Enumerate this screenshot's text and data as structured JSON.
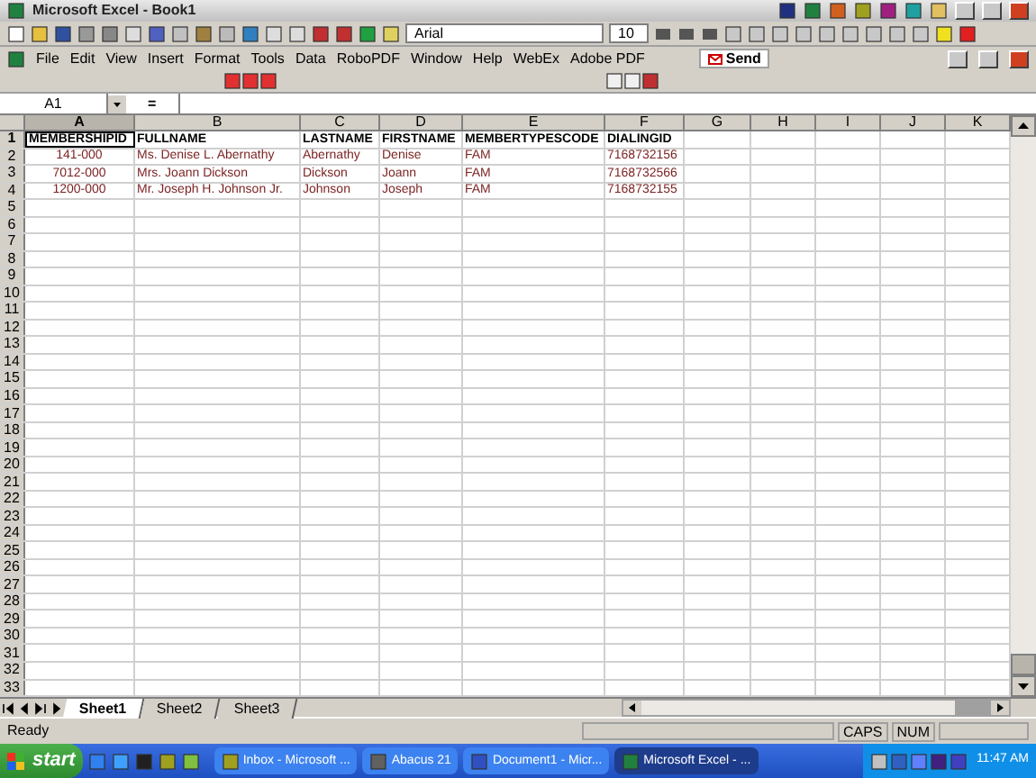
{
  "window": {
    "title": "Microsoft Excel - Book1"
  },
  "toolbar": {
    "font": "Arial",
    "size": "10"
  },
  "menu": [
    "File",
    "Edit",
    "View",
    "Insert",
    "Format",
    "Tools",
    "Data",
    "RoboPDF",
    "Window",
    "Help",
    "WebEx",
    "Adobe PDF"
  ],
  "send_button": "Send",
  "formula_bar": {
    "name_box": "A1",
    "equals": "="
  },
  "columns": [
    {
      "label": "A",
      "selected": true
    },
    {
      "label": "B",
      "selected": false
    },
    {
      "label": "C",
      "selected": false
    },
    {
      "label": "D",
      "selected": false
    },
    {
      "label": "E",
      "selected": false
    },
    {
      "label": "F",
      "selected": false
    },
    {
      "label": "G",
      "selected": false
    },
    {
      "label": "H",
      "selected": false
    },
    {
      "label": "I",
      "selected": false
    },
    {
      "label": "J",
      "selected": false
    },
    {
      "label": "K",
      "selected": false
    }
  ],
  "rows": [
    {
      "number": "1",
      "selected": true,
      "kind": "header",
      "cells": [
        "MEMBERSHIPID",
        "FULLNAME",
        "LASTNAME",
        "FIRSTNAME",
        "MEMBERTYPESCODE",
        "DIALINGID"
      ]
    },
    {
      "number": "2",
      "selected": false,
      "kind": "data",
      "cells": [
        "141-000",
        "Ms. Denise L. Abernathy",
        "Abernathy",
        "Denise",
        "FAM",
        "7168732156"
      ]
    },
    {
      "number": "3",
      "selected": false,
      "kind": "data",
      "cells": [
        "7012-000",
        "Mrs. Joann Dickson",
        "Dickson",
        "Joann",
        "FAM",
        "7168732566"
      ]
    },
    {
      "number": "4",
      "selected": false,
      "kind": "data",
      "cells": [
        "1200-000",
        "Mr. Joseph H. Johnson Jr.",
        "Johnson",
        "Joseph",
        "FAM",
        "7168732155"
      ]
    },
    {
      "number": "5",
      "selected": false,
      "kind": "empty"
    },
    {
      "number": "6",
      "selected": false,
      "kind": "empty"
    },
    {
      "number": "7",
      "selected": false,
      "kind": "empty"
    },
    {
      "number": "8",
      "selected": false,
      "kind": "empty"
    },
    {
      "number": "9",
      "selected": false,
      "kind": "empty"
    },
    {
      "number": "10",
      "selected": false,
      "kind": "empty"
    },
    {
      "number": "11",
      "selected": false,
      "kind": "empty"
    },
    {
      "number": "12",
      "selected": false,
      "kind": "empty"
    },
    {
      "number": "13",
      "selected": false,
      "kind": "empty"
    },
    {
      "number": "14",
      "selected": false,
      "kind": "empty"
    },
    {
      "number": "15",
      "selected": false,
      "kind": "empty"
    },
    {
      "number": "16",
      "selected": false,
      "kind": "empty"
    },
    {
      "number": "17",
      "selected": false,
      "kind": "empty"
    },
    {
      "number": "18",
      "selected": false,
      "kind": "empty"
    },
    {
      "number": "19",
      "selected": false,
      "kind": "empty"
    },
    {
      "number": "20",
      "selected": false,
      "kind": "empty"
    },
    {
      "number": "21",
      "selected": false,
      "kind": "empty"
    },
    {
      "number": "22",
      "selected": false,
      "kind": "empty"
    },
    {
      "number": "23",
      "selected": false,
      "kind": "empty"
    },
    {
      "number": "24",
      "selected": false,
      "kind": "empty"
    },
    {
      "number": "25",
      "selected": false,
      "kind": "empty"
    },
    {
      "number": "26",
      "selected": false,
      "kind": "empty"
    },
    {
      "number": "27",
      "selected": false,
      "kind": "empty"
    },
    {
      "number": "28",
      "selected": false,
      "kind": "empty"
    },
    {
      "number": "29",
      "selected": false,
      "kind": "empty"
    },
    {
      "number": "30",
      "selected": false,
      "kind": "empty"
    },
    {
      "number": "31",
      "selected": false,
      "kind": "empty"
    },
    {
      "number": "32",
      "selected": false,
      "kind": "empty"
    },
    {
      "number": "33",
      "selected": false,
      "kind": "empty"
    }
  ],
  "sheet_tabs": [
    {
      "label": "Sheet1",
      "selected": true
    },
    {
      "label": "Sheet2",
      "selected": false
    },
    {
      "label": "Sheet3",
      "selected": false
    }
  ],
  "status_bar": {
    "text": "Ready",
    "indicators": [
      "CAPS",
      "NUM"
    ]
  },
  "taskbar": {
    "start": "start",
    "tasks": [
      {
        "label": "Inbox - Microsoft ...",
        "selected": false
      },
      {
        "label": "Abacus 21",
        "selected": false
      },
      {
        "label": "Document1 - Micr...",
        "selected": false
      },
      {
        "label": "Microsoft Excel - ...",
        "selected": true
      }
    ],
    "clock": "11:47 AM"
  }
}
